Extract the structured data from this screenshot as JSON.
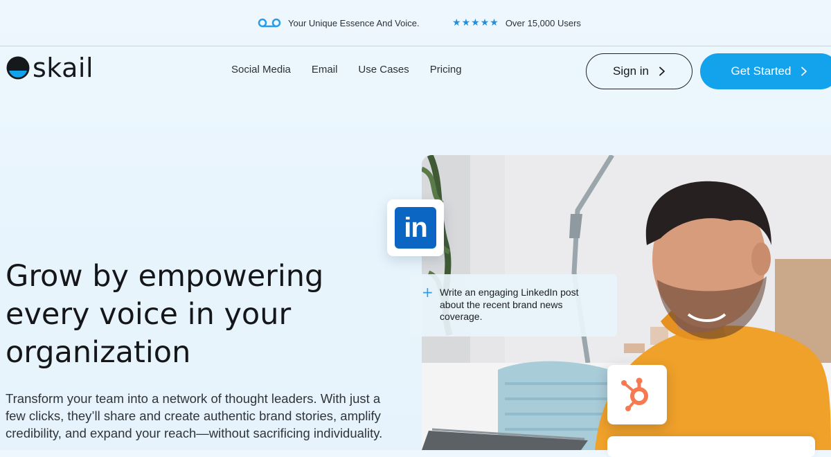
{
  "topbar": {
    "voice_icon": "voicemail-icon",
    "voice_text": "Your Unique Essence And Voice.",
    "rating_stars": 5,
    "users_text": "Over 15,000 Users"
  },
  "header": {
    "logo_text": "skail",
    "nav": [
      {
        "label": "Social Media"
      },
      {
        "label": "Email"
      },
      {
        "label": "Use Cases"
      },
      {
        "label": "Pricing"
      }
    ],
    "signin_label": "Sign in",
    "get_started_label": "Get Started"
  },
  "hero": {
    "title": "Grow by empowering every voice in your organization",
    "subtitle": "Transform your team into a network of thought leaders. With just a few clicks, they’ll share and create authentic brand stories, amplify credibility, and expand your reach—without sacrificing individuality."
  },
  "visual": {
    "linkedin_icon_text": "in",
    "prompt_text": "Write an engaging LinkedIn post about  the recent brand news coverage."
  },
  "colors": {
    "accent": "#13a2ec",
    "linkedin": "#0a66c2",
    "hubspot": "#f57a52",
    "star": "#1f8fe0"
  }
}
